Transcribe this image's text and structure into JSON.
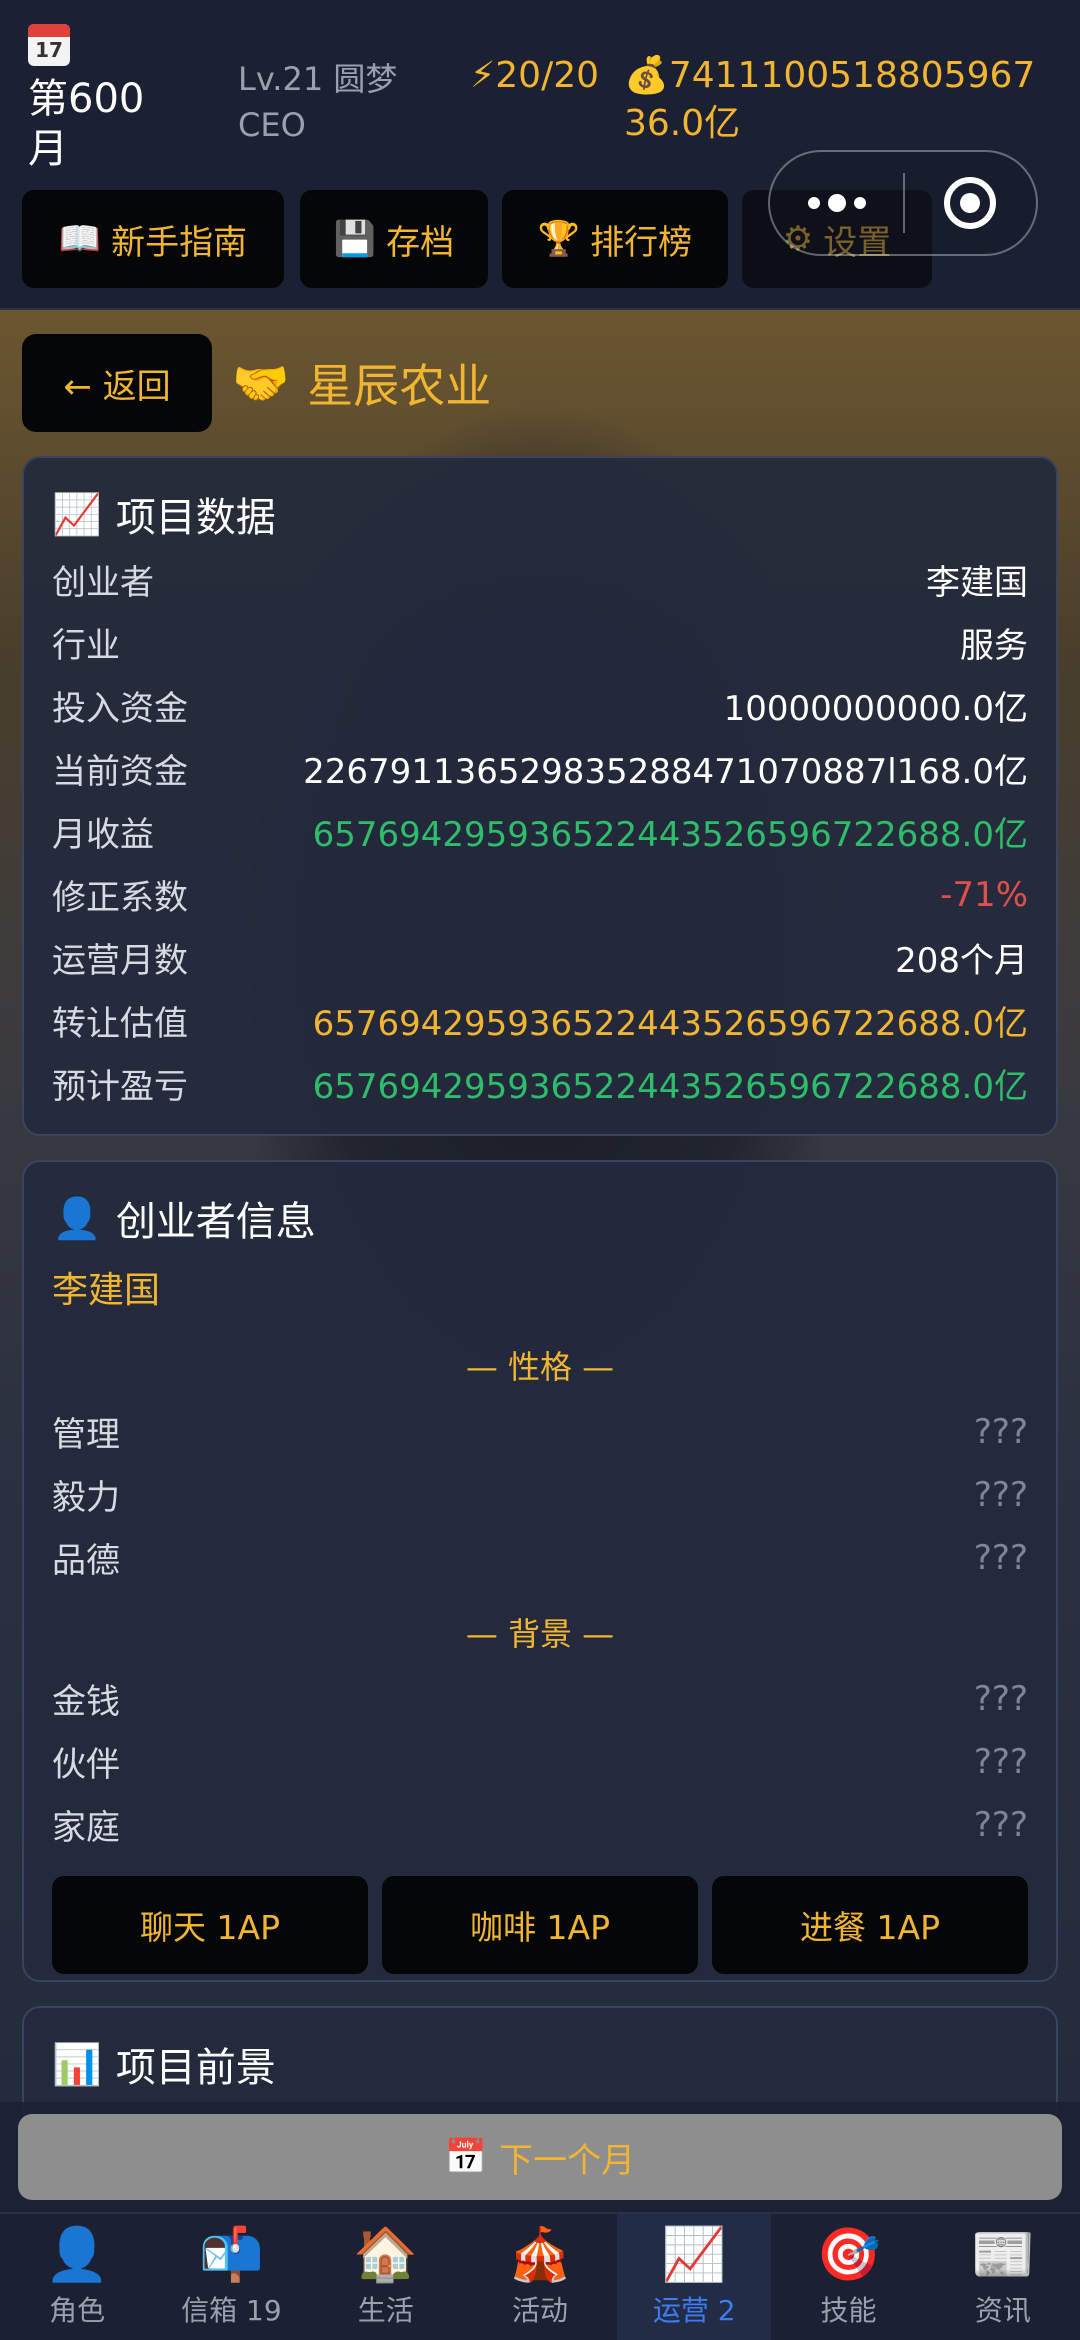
{
  "status": {
    "cal_day": "17",
    "month": "第600月",
    "level": "Lv.21 圆梦CEO",
    "energy": "⚡20/20",
    "money": "💰741110051880596736.0亿"
  },
  "toolbar": {
    "guide": "新手指南",
    "save": "存档",
    "rank": "排行榜",
    "settings": "设置"
  },
  "header": {
    "back": "← 返回",
    "title": "星辰农业"
  },
  "project_data": {
    "title": "项目数据",
    "rows": [
      {
        "k": "创业者",
        "v": "李建国"
      },
      {
        "k": "行业",
        "v": "服务"
      },
      {
        "k": "投入资金",
        "v": "10000000000.0亿"
      },
      {
        "k": "当前资金",
        "v": "226791136529835288471070887l168.0亿"
      },
      {
        "k": "月收益",
        "v": "657694295936522443526596722688.0亿"
      },
      {
        "k": "修正系数",
        "v": "-71%"
      },
      {
        "k": "运营月数",
        "v": "208个月"
      },
      {
        "k": "转让估值",
        "v": "657694295936522443526596722688.0亿"
      },
      {
        "k": "预计盈亏",
        "v": "657694295936522443526596722688.0亿"
      }
    ]
  },
  "founder": {
    "title": "创业者信息",
    "name": "李建国",
    "personality_head": "— 性格 —",
    "personality": [
      {
        "k": "管理",
        "v": "???"
      },
      {
        "k": "毅力",
        "v": "???"
      },
      {
        "k": "品德",
        "v": "???"
      }
    ],
    "background_head": "— 背景 —",
    "background": [
      {
        "k": "金钱",
        "v": "???"
      },
      {
        "k": "伙伴",
        "v": "???"
      },
      {
        "k": "家庭",
        "v": "???"
      }
    ],
    "actions": [
      "聊天 1AP",
      "咖啡 1AP",
      "进餐 1AP"
    ]
  },
  "prospect": {
    "title": "项目前景"
  },
  "next_month": "下一个月",
  "nav": [
    {
      "icon": "👤",
      "label": "角色"
    },
    {
      "icon": "📬",
      "label": "信箱 19"
    },
    {
      "icon": "🏠",
      "label": "生活"
    },
    {
      "icon": "🎪",
      "label": "活动"
    },
    {
      "icon": "📈",
      "label": "运营 2"
    },
    {
      "icon": "🎯",
      "label": "技能"
    },
    {
      "icon": "📰",
      "label": "资讯"
    }
  ],
  "colors": {
    "accent": "#f1b531",
    "positive": "#2ebd6b",
    "negative": "#e0504a",
    "active_nav": "#3e7cf0"
  }
}
